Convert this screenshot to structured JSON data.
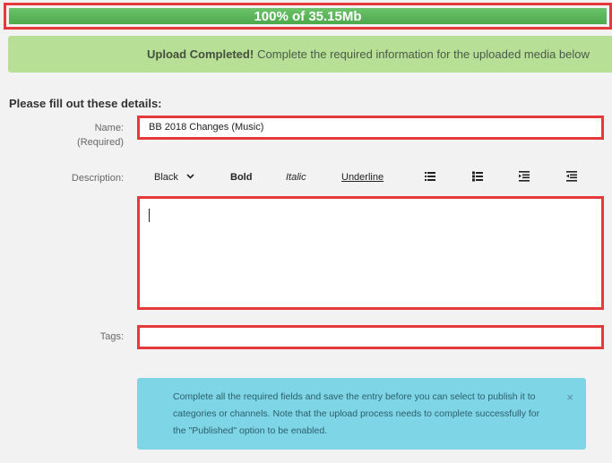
{
  "upload": {
    "progress_text": "100% of 35.15Mb",
    "progress_fraction": 1.0
  },
  "success_alert": {
    "strong": "Upload Completed!",
    "message": "Complete the required information for the uploaded media below"
  },
  "form": {
    "title": "Please fill out these details:",
    "name_label": "Name:",
    "name_required": "(Required)",
    "name_value": "BB 2018 Changes (Music)",
    "description_label": "Description:",
    "tags_label": "Tags:",
    "toolbar": {
      "color_select": "Black",
      "bold": "Bold",
      "italic": "Italic",
      "underline": "Underline"
    }
  },
  "info_alert": {
    "message": "Complete all the required fields and save the entry before you can select to publish it to categories or channels. Note that the upload process needs to complete successfully for the \"Published\" option to be enabled.",
    "close": "×"
  },
  "colors": {
    "highlight": "#e5393d",
    "progress": "#55af52",
    "success_bg": "#b7e096",
    "info_bg": "#7dd5e6"
  }
}
